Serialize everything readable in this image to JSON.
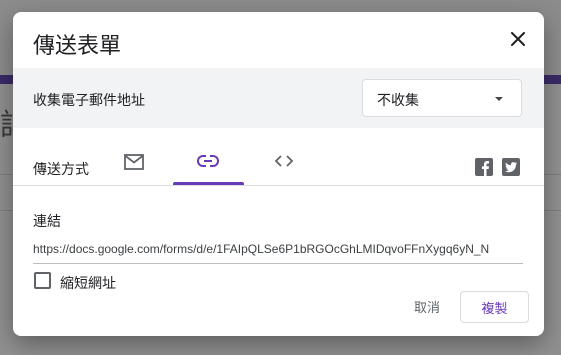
{
  "dialog": {
    "title": "傳送表單",
    "close_icon": "close-icon"
  },
  "collect_email": {
    "label": "收集電子郵件地址",
    "selected": "不收集"
  },
  "send_via": {
    "label": "傳送方式",
    "tabs": [
      {
        "icon": "email-icon",
        "active": false
      },
      {
        "icon": "link-icon",
        "active": true
      },
      {
        "icon": "embed-code-icon",
        "active": false
      }
    ],
    "share_icons": [
      "facebook-icon",
      "twitter-icon"
    ]
  },
  "link": {
    "heading": "連結",
    "url": "https://docs.google.com/forms/d/e/1FAIpQLSe6P1bRGOcGhLMIDqvoFFnXygq6yN_N",
    "shorten_label": "縮短網址",
    "shorten_checked": false
  },
  "actions": {
    "cancel_label": "取消",
    "copy_label": "複製"
  },
  "colors": {
    "accent": "#673ab7",
    "background_purple": "#3b2a66"
  },
  "background": {
    "partial_char": "詳"
  }
}
